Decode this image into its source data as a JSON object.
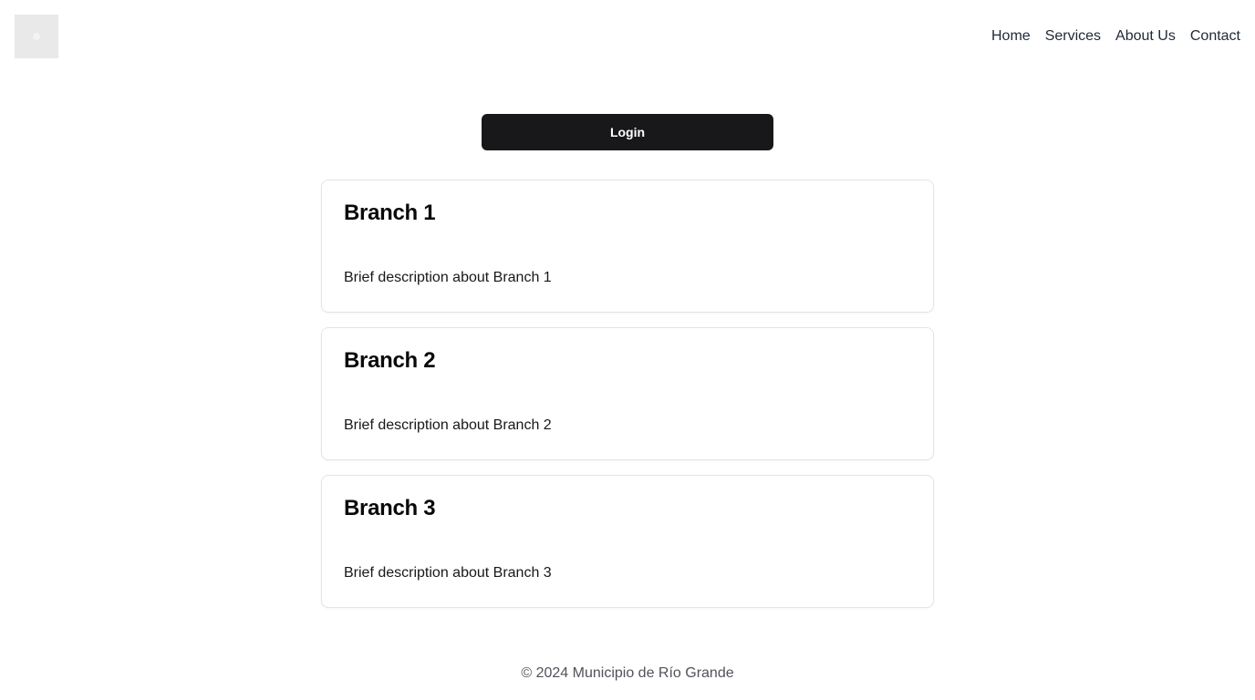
{
  "header": {
    "logo_icon": "image-placeholder-icon",
    "nav": [
      {
        "label": "Home"
      },
      {
        "label": "Services"
      },
      {
        "label": "About Us"
      },
      {
        "label": "Contact"
      }
    ]
  },
  "main": {
    "login_label": "Login",
    "branches": [
      {
        "title": "Branch 1",
        "description": "Brief description about Branch 1"
      },
      {
        "title": "Branch 2",
        "description": "Brief description about Branch 2"
      },
      {
        "title": "Branch 3",
        "description": "Brief description about Branch 3"
      }
    ]
  },
  "footer": {
    "text": "© 2024 Municipio de Río Grande"
  },
  "colors": {
    "button_bg": "#18181b",
    "button_text": "#ffffff",
    "card_border": "#e4e4e7",
    "footer_text": "#52525b",
    "logo_bg": "#e9e9e9"
  }
}
